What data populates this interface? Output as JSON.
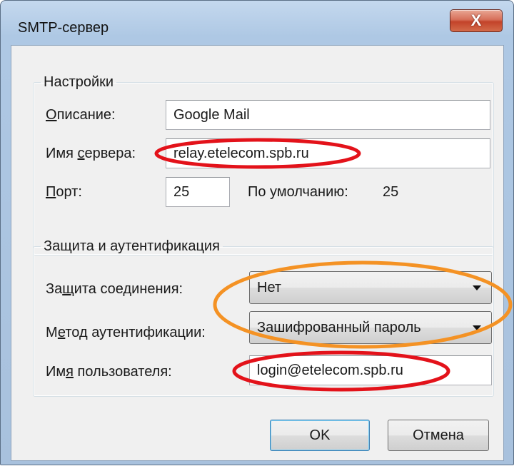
{
  "window": {
    "title": "SMTP-сервер",
    "close_glyph": "X"
  },
  "settings": {
    "legend": "Настройки",
    "description": {
      "label_first": "О",
      "label_rest": "писание:",
      "value": "Google Mail"
    },
    "server": {
      "label_pre": "Имя ",
      "label_u": "с",
      "label_post": "ервера:",
      "value": "relay.etelecom.spb.ru"
    },
    "port": {
      "label_first": "П",
      "label_rest": "орт:",
      "value": "25",
      "default_label": "По умолчанию:",
      "default_value": "25"
    }
  },
  "security": {
    "legend": "Защита и аутентификация",
    "connection": {
      "label_pre": "За",
      "label_u": "щ",
      "label_post": "ита соединения:",
      "value": "Нет"
    },
    "auth": {
      "label_pre": "М",
      "label_u": "е",
      "label_post": "тод аутентификации:",
      "value": "Зашифрованный пароль"
    },
    "username": {
      "label_pre": "Им",
      "label_u": "я",
      "label_post": " пользователя:",
      "value": "login@etelecom.spb.ru"
    }
  },
  "buttons": {
    "ok": "OK",
    "cancel": "Отмена"
  },
  "colors": {
    "annotation_red": "#e3121a",
    "annotation_orange": "#f49224"
  }
}
